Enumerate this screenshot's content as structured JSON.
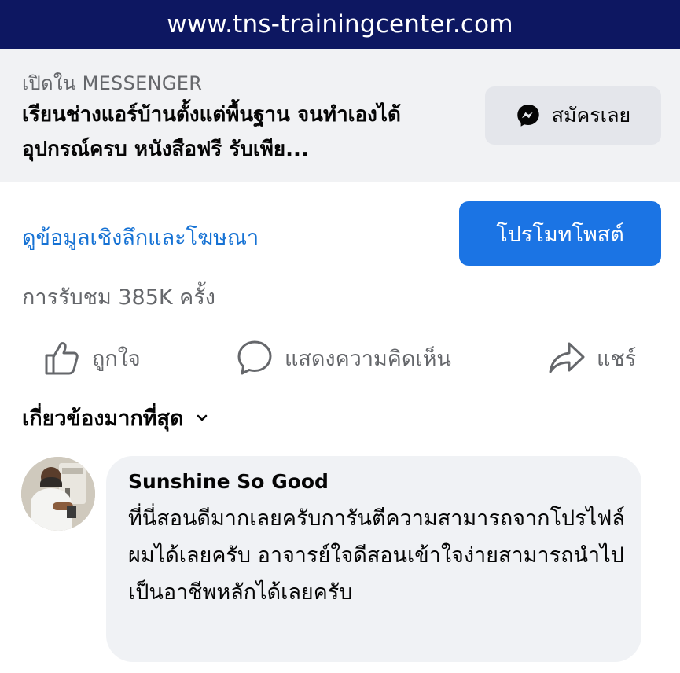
{
  "banner": {
    "url": "www.tns-trainingcenter.com"
  },
  "messenger": {
    "open_in": "เปิดใน MESSENGER",
    "ad_title": "เรียนช่างแอร์บ้านตั้งแต่พื้นฐาน จนทำเองได้ อุปกรณ์ครบ หนังสือฟรี รับเพีย...",
    "signup_label": "สมัครเลย",
    "icon": "messenger-icon"
  },
  "insights": {
    "link_label": "ดูข้อมูลเชิงลึกและโฆษณา",
    "promote_label": "โปรโมทโพสต์"
  },
  "stats": {
    "views": "การรับชม 385K ครั้ง"
  },
  "actions": {
    "like_label": "ถูกใจ",
    "comment_label": "แสดงความคิดเห็น",
    "share_label": "แชร์"
  },
  "comments": {
    "sort_label": "เกี่ยวข้องมากที่สุด",
    "items": [
      {
        "author": "Sunshine So Good",
        "text": "ที่นี่สอนดีมากเลยครับการันตีความสามารถจากโปรไฟล์ผมได้เลยครับ อาจารย์ใจดีสอนเข้าใจง่ายสามารถนำไปเป็นอาชีพหลักได้เลยครับ"
      }
    ]
  },
  "colors": {
    "banner_bg": "#0d1761",
    "link_blue": "#1672d4",
    "button_blue": "#1b74e4",
    "panel_gray": "#f1f2f4",
    "bubble_gray": "#f0f2f5",
    "secondary_text": "#65676b"
  }
}
